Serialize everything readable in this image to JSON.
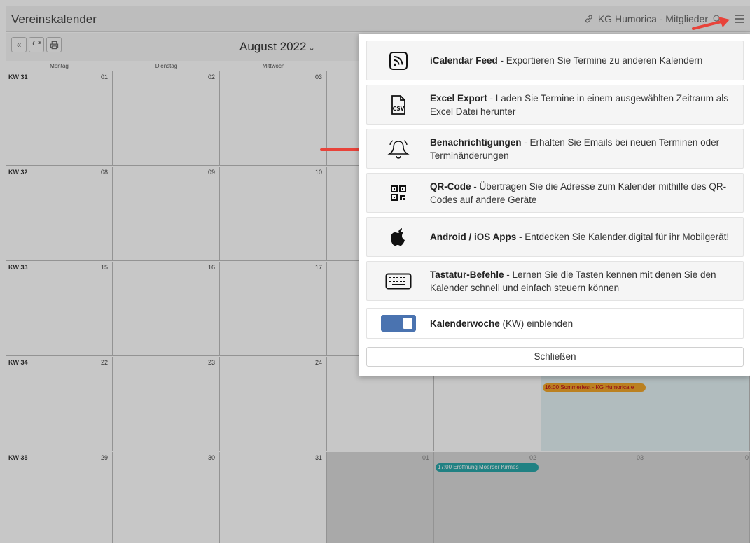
{
  "header": {
    "title": "Vereinskalender",
    "calendar_name": "KG Humorica - Mitglieder"
  },
  "toolbar": {
    "month": "August 2022",
    "back_label": "«"
  },
  "weekdays": [
    "Montag",
    "Dienstag",
    "Mittwoch"
  ],
  "weeks": [
    {
      "kw": "KW 31",
      "days": [
        "01",
        "02",
        "03"
      ]
    },
    {
      "kw": "KW 32",
      "days": [
        "08",
        "09",
        "10"
      ]
    },
    {
      "kw": "KW 33",
      "days": [
        "15",
        "16",
        "17"
      ]
    },
    {
      "kw": "KW 34",
      "days": [
        "22",
        "23",
        "24"
      ]
    },
    {
      "kw": "KW 35",
      "days": [
        "29",
        "30",
        "31",
        "01",
        "02",
        "03",
        "0"
      ]
    }
  ],
  "events": {
    "kirmes": "17:00 Eröffnung Moerser Kirmes",
    "sommerfest": "16:00 Sommerfest - KG Humorica e"
  },
  "menu": {
    "items": [
      {
        "title": "iCalendar Feed",
        "desc": " - Exportieren Sie Termine zu anderen Kalendern"
      },
      {
        "title": "Excel Export",
        "desc": " - Laden Sie Termine in einem ausgewählten Zeitraum als Excel Datei herunter"
      },
      {
        "title": "Benachrichtigungen",
        "desc": " - Erhalten Sie Emails bei neuen Terminen oder Terminänderungen"
      },
      {
        "title": "QR-Code",
        "desc": " - Übertragen Sie die Adresse zum Kalender mithilfe des QR-Codes auf andere Geräte"
      },
      {
        "title": "Android / iOS Apps",
        "desc": " - Entdecken Sie Kalender.digital für ihr Mobilgerät!"
      },
      {
        "title": "Tastatur-Befehle",
        "desc": " - Lernen Sie die Tasten kennen mit denen Sie den Kalender schnell und einfach steuern können"
      },
      {
        "title": "Kalenderwoche",
        "desc": " (KW) einblenden"
      }
    ],
    "csv_label": "CSV",
    "close_label": "Schließen"
  },
  "colors": {
    "accent": "#4a73b0",
    "arrow": "#e8433a",
    "event_teal": "#2aa6a8",
    "event_orange": "#f0a62b"
  }
}
